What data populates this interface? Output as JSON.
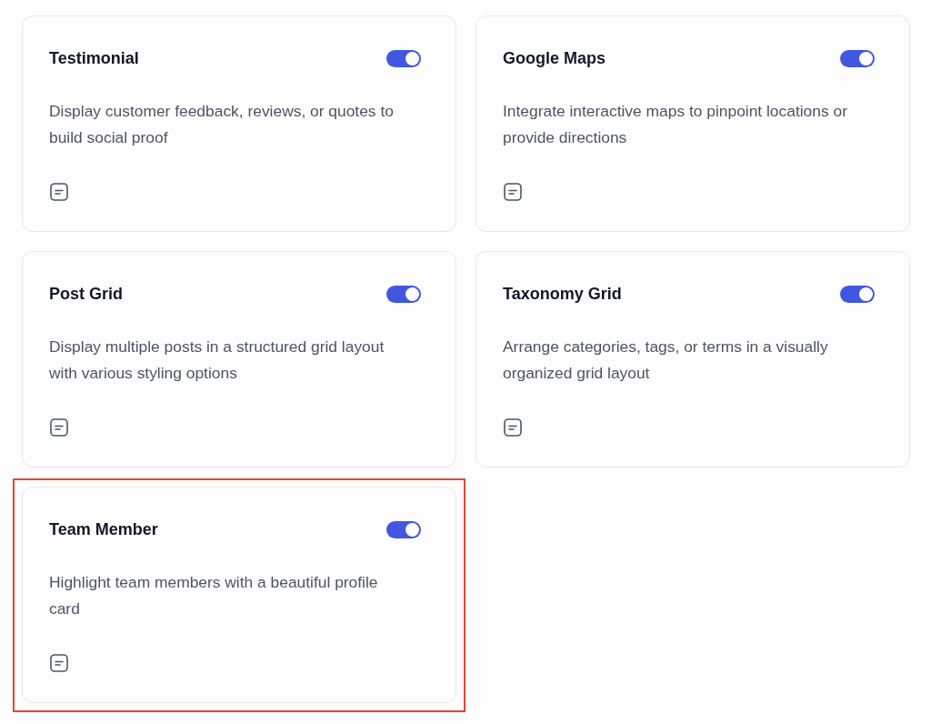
{
  "cards": [
    {
      "title": "Testimonial",
      "on": true,
      "description": "Display customer feedback, reviews, or quotes to build social proof",
      "highlighted": false
    },
    {
      "title": "Google Maps",
      "on": true,
      "description": "Integrate interactive maps to pinpoint locations or provide directions",
      "highlighted": false
    },
    {
      "title": "Post Grid",
      "on": true,
      "description": "Display multiple posts in a structured grid layout with various styling options",
      "highlighted": false
    },
    {
      "title": "Taxonomy Grid",
      "on": true,
      "description": "Arrange categories, tags, or terms in a visually organized grid layout",
      "highlighted": false
    },
    {
      "title": "Team Member",
      "on": true,
      "description": "Highlight team members with a beautiful profile card",
      "highlighted": true
    }
  ]
}
